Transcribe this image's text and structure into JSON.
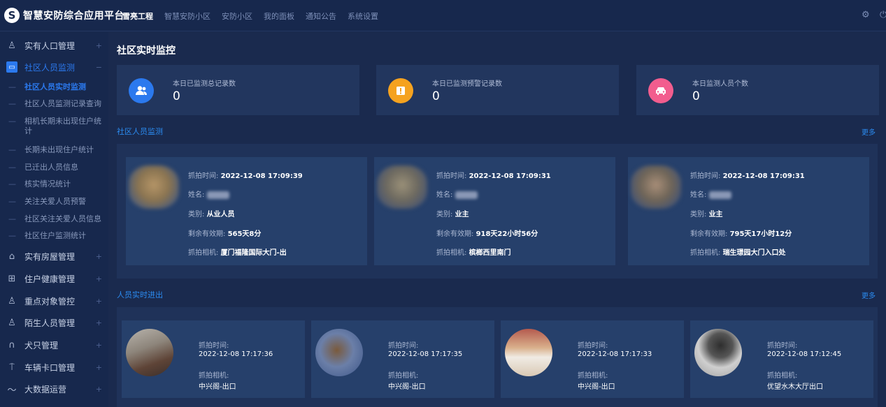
{
  "header": {
    "logo_mark": "S",
    "app_title": "智慧安防综合应用平台",
    "nav": [
      "雪亮工程",
      "智慧安防小区",
      "安防小区",
      "我的面板",
      "通知公告",
      "系统设置"
    ]
  },
  "sidebar": {
    "items": [
      {
        "label": "实有人口管理",
        "icon": "person-outline-icon"
      },
      {
        "label": "社区人员监测",
        "icon": "camera-icon"
      },
      {
        "label": "实有房屋管理",
        "icon": "house-icon"
      },
      {
        "label": "住户健康管理",
        "icon": "medical-kit-icon"
      },
      {
        "label": "重点对象管控",
        "icon": "person-key-icon"
      },
      {
        "label": "陌生人员管理",
        "icon": "person-question-icon"
      },
      {
        "label": "犬只管理",
        "icon": "dog-icon"
      },
      {
        "label": "车辆卡口管理",
        "icon": "barrier-icon"
      },
      {
        "label": "大数据运营",
        "icon": "trend-icon"
      }
    ],
    "subitems": [
      "社区人员实时监测",
      "社区人员监测记录查询",
      "相机长期未出现住户统计",
      "长期未出现住户统计",
      "已迁出人员信息",
      "核实情况统计",
      "关注关爱人员预警",
      "社区关注关爱人员信息",
      "社区住户监测统计"
    ],
    "plus": "+",
    "minus": "−",
    "dash": "—"
  },
  "main": {
    "page_title": "社区实时监控",
    "stats": [
      {
        "label": "本日已监测总记录数",
        "value": "0",
        "color": "#2b79ee",
        "icon": "people-icon"
      },
      {
        "label": "本日已监测预警记录数",
        "value": "0",
        "color": "#f5a21f",
        "icon": "warning-icon"
      },
      {
        "label": "本日监测人员个数",
        "value": "0",
        "color": "#f25d8e",
        "icon": "car-icon"
      }
    ],
    "monitor": {
      "title": "社区人员监测",
      "more": "更多",
      "labels": {
        "time": "抓拍时间: ",
        "name": "姓名: ",
        "type": "类别: ",
        "valid": "剩余有效期: ",
        "camera": "抓拍相机: "
      },
      "cards": [
        {
          "time": "2022-12-08 17:09:39",
          "type": "从业人员",
          "valid": "565天8分",
          "camera": "厦门福隆国际大门-出"
        },
        {
          "time": "2022-12-08 17:09:31",
          "type": "业主",
          "valid": "918天22小时56分",
          "camera": "槟榔西里南门"
        },
        {
          "time": "2022-12-08 17:09:31",
          "type": "业主",
          "valid": "795天17小时12分",
          "camera": "瑞生璟园大门入口处"
        }
      ]
    },
    "realtime": {
      "title": "人员实时进出",
      "more": "更多",
      "time_label": "抓拍时间:",
      "camera_label": "抓拍相机:",
      "cards": [
        {
          "time": "2022-12-08 17:17:36",
          "camera": "中兴阁-出口"
        },
        {
          "time": "2022-12-08 17:17:35",
          "camera": "中兴阁-出口"
        },
        {
          "time": "2022-12-08 17:17:33",
          "camera": "中兴阁-出口"
        },
        {
          "time": "2022-12-08 17:12:45",
          "camera": "优望水木大厅出口"
        }
      ]
    }
  }
}
